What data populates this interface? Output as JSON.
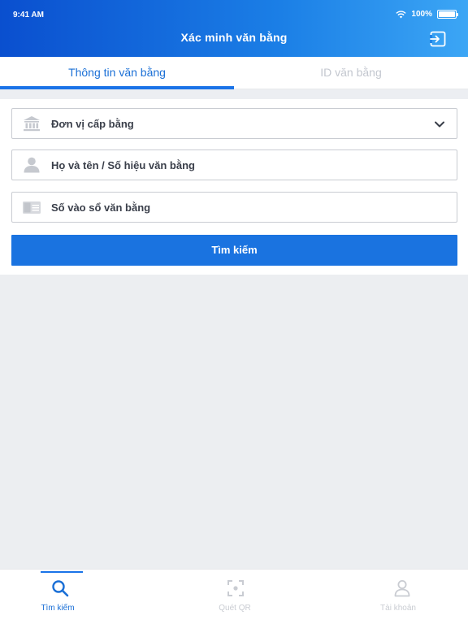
{
  "status_bar": {
    "time": "9:41 AM",
    "battery": "100%"
  },
  "header": {
    "title": "Xác minh văn bằng",
    "logout_icon": "logout-icon"
  },
  "tabs": [
    {
      "label": "Thông tin văn bằng",
      "active": true
    },
    {
      "label": "ID văn bằng",
      "active": false
    }
  ],
  "form": {
    "issuer": {
      "label": "Đơn vị cấp bằng",
      "icon": "bank-icon"
    },
    "name": {
      "label": "Họ và tên / Số hiệu văn bằng",
      "icon": "person-icon"
    },
    "registry": {
      "label": "Số vào sổ văn bằng",
      "icon": "id-card-icon"
    },
    "search_button": "Tìm kiếm"
  },
  "bottom_nav": [
    {
      "label": "Tìm kiếm",
      "icon": "search-icon",
      "active": true
    },
    {
      "label": "Quét QR",
      "icon": "qr-scan-icon",
      "active": false
    },
    {
      "label": "Tài khoản",
      "icon": "account-icon",
      "active": false
    }
  ],
  "colors": {
    "primary": "#1a73e0",
    "header_start": "#0a4fcf",
    "header_end": "#3ca6f5",
    "inactive": "#c9ccd2"
  }
}
